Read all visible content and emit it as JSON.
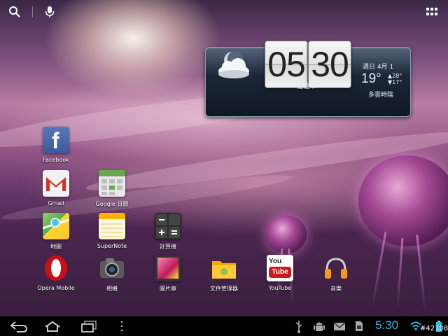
{
  "top_bar": {
    "search_icon": "search-icon",
    "mic_icon": "mic-icon",
    "apps_icon": "all-apps-grid-icon"
  },
  "widget": {
    "hour": "05",
    "minute": "30",
    "city": "嘉義市",
    "date": "週日 4月 1",
    "temperature": "19°",
    "high": "▲28°",
    "low": "▼17°",
    "condition": "多雲時陰",
    "weather_icon": "partly-cloudy-night-icon"
  },
  "apps": [
    {
      "label": "Facebook",
      "icon": "facebook-icon",
      "color": "#3b5998"
    },
    {
      "label": "Gmail",
      "icon": "gmail-icon",
      "color": "#d93025"
    },
    {
      "label": "Google 日曆",
      "icon": "calendar-icon",
      "color": "#6aa84f"
    },
    {
      "label": "地圖",
      "icon": "maps-icon",
      "color": "#4caf50"
    },
    {
      "label": "SuperNote",
      "icon": "notepad-icon",
      "color": "#f4b400"
    },
    {
      "label": "計算機",
      "icon": "calculator-icon",
      "color": "#333333"
    },
    {
      "label": "Opera Mobile",
      "icon": "opera-icon",
      "color": "#cc0f16"
    },
    {
      "label": "相機",
      "icon": "camera-icon",
      "color": "#555555"
    },
    {
      "label": "圖片庫",
      "icon": "gallery-icon",
      "color": "#c2185b"
    },
    {
      "label": "文件管理器",
      "icon": "folder-icon",
      "color": "#f2a900"
    },
    {
      "label": "YouTube",
      "icon": "youtube-icon",
      "color": "#cc181e"
    },
    {
      "label": "音樂",
      "icon": "headphones-icon",
      "color": "#f39c12"
    }
  ],
  "nav_bar": {
    "back_icon": "back-icon",
    "home_icon": "home-icon",
    "recents_icon": "recent-apps-icon",
    "menu_icon": "overflow-menu-icon",
    "usb_icon": "usb-icon",
    "android_icon": "android-debug-icon",
    "gmail_notif_icon": "gmail-notification-icon",
    "sd_icon": "sd-card-icon",
    "time": "5:30",
    "wifi_icon": "wifi-icon",
    "battery_icon": "battery-icon"
  },
  "watermark": "#42108",
  "accent_color": "#33b5e5"
}
